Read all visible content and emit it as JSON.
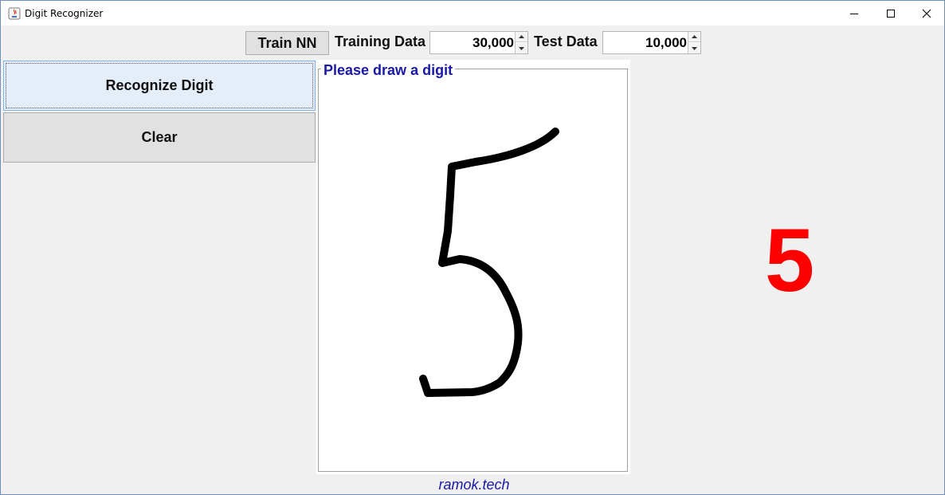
{
  "window": {
    "title": "Digit Recognizer"
  },
  "toolbar": {
    "train_label": "Train NN",
    "training_data_label": "Training Data",
    "training_data_value": "30,000",
    "test_data_label": "Test Data",
    "test_data_value": "10,000"
  },
  "actions": {
    "recognize_label": "Recognize Digit",
    "clear_label": "Clear"
  },
  "draw_panel": {
    "title": "Please draw a digit"
  },
  "result": {
    "digit": "5",
    "color": "#ff0000"
  },
  "footer": {
    "text": "ramok.tech"
  },
  "colors": {
    "accent_text": "#1919a6",
    "focus_button": "#e5eef8"
  }
}
